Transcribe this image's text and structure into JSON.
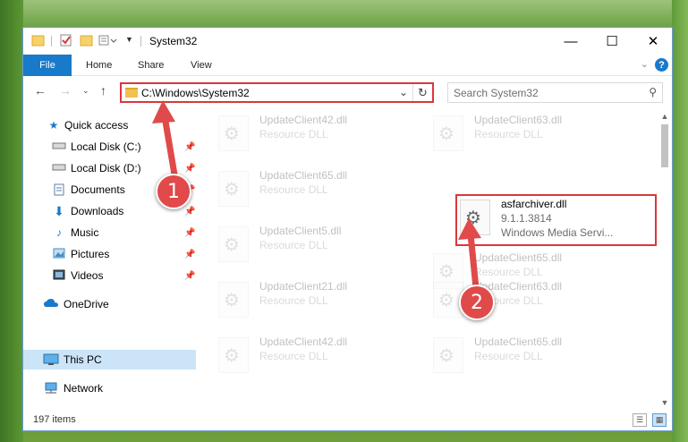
{
  "window": {
    "title": "System32",
    "minimize_icon": "minimize-icon",
    "maximize_icon": "maximize-icon",
    "close_icon": "close-icon"
  },
  "ribbon": {
    "tabs": [
      {
        "label": "File",
        "active": true
      },
      {
        "label": "Home"
      },
      {
        "label": "Share"
      },
      {
        "label": "View"
      }
    ],
    "help_glyph": "?"
  },
  "navigation": {
    "address": "C:\\Windows\\System32",
    "search_placeholder": "Search System32"
  },
  "sidebar": {
    "items": [
      {
        "label": "Quick access",
        "icon": "star-icon"
      },
      {
        "label": "Local Disk (C:)",
        "icon": "drive-icon",
        "pinned": true
      },
      {
        "label": "Local Disk (D:)",
        "icon": "drive-icon",
        "pinned": true
      },
      {
        "label": "Documents",
        "icon": "documents-icon",
        "pinned": true
      },
      {
        "label": "Downloads",
        "icon": "downloads-icon",
        "pinned": true
      },
      {
        "label": "Music",
        "icon": "music-icon",
        "pinned": true
      },
      {
        "label": "Pictures",
        "icon": "pictures-icon",
        "pinned": true
      },
      {
        "label": "Videos",
        "icon": "videos-icon",
        "pinned": true
      },
      {
        "label": "OneDrive",
        "icon": "cloud-icon"
      },
      {
        "label": "This PC",
        "icon": "computer-icon",
        "selected": true
      },
      {
        "label": "Network",
        "icon": "network-icon"
      }
    ]
  },
  "files": [
    {
      "name": "UpdateClient42.dll",
      "type": "Resource DLL"
    },
    {
      "name": "UpdateClient63.dll",
      "type": "Resource DLL"
    },
    {
      "name": "UpdateClient65.dll",
      "type": "Resource DLL"
    },
    {
      "name": "asfarchiver.dll",
      "type": "9.1.1.3814",
      "desc": "Windows Media Servi..."
    },
    {
      "name": "UpdateClient5.dll",
      "type": "Resource DLL"
    },
    {
      "name": "UpdateClient65.dll",
      "type": "Resource DLL"
    },
    {
      "name": "UpdateClient21.dll",
      "type": "Resource DLL"
    },
    {
      "name": "UpdateClient63.dll",
      "type": "Resource DLL"
    },
    {
      "name": "UpdateClient42.dll",
      "type": "Resource DLL"
    },
    {
      "name": "UpdateClient65.dll",
      "type": "Resource DLL"
    }
  ],
  "status": {
    "item_count": "197 items"
  },
  "callouts": [
    "1",
    "2"
  ],
  "colors": {
    "accent": "#1979ca",
    "highlight_red": "#d9383a",
    "callout_red": "#e04a4a",
    "selection": "#cce4f7"
  }
}
